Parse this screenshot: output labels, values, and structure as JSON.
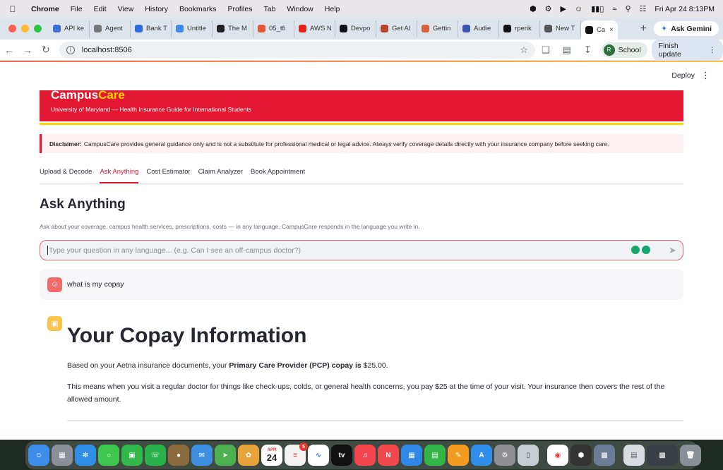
{
  "menubar": {
    "app": "Chrome",
    "items": [
      "File",
      "Edit",
      "View",
      "History",
      "Bookmarks",
      "Profiles",
      "Tab",
      "Window",
      "Help"
    ],
    "clock": "Fri Apr 24  8:13PM"
  },
  "tabs": [
    {
      "title": "API ke",
      "color": "#3a6fd8"
    },
    {
      "title": "Agent",
      "color": "#777777"
    },
    {
      "title": "Bank T",
      "color": "#2d6ae3"
    },
    {
      "title": "Untitle",
      "color": "#4285f4"
    },
    {
      "title": "The M",
      "color": "#222222"
    },
    {
      "title": "05_tfi",
      "color": "#e8553a"
    },
    {
      "title": "AWS N",
      "color": "#e62117"
    },
    {
      "title": "Devpo",
      "color": "#111111"
    },
    {
      "title": "Get AI",
      "color": "#b5432f"
    },
    {
      "title": "Gettin",
      "color": "#d9613f"
    },
    {
      "title": "Audie",
      "color": "#3955b8"
    },
    {
      "title": "rperik",
      "color": "#111111"
    },
    {
      "title": "New T",
      "color": "#555555"
    },
    {
      "title": "Ca",
      "color": "#111111"
    }
  ],
  "gemini_label": "Ask Gemini",
  "url": "localhost:8506",
  "profile": {
    "initial": "R",
    "name": "School"
  },
  "finish_update": "Finish update",
  "app": {
    "deploy": "Deploy",
    "brand_campus": "Campus",
    "brand_care": "Care",
    "subtitle": "University of Maryland — Health Insurance Guide for International Students",
    "disclaimer_label": "Disclaimer:",
    "disclaimer_text": "CampusCare provides general guidance only and is not a substitute for professional medical or legal advice. Always verify coverage details directly with your insurance company before seeking care.",
    "tabs": [
      "Upload & Decode",
      "Ask Anything",
      "Cost Estimator",
      "Claim Analyzer",
      "Book Appointment"
    ],
    "active_tab": "Ask Anything",
    "heading": "Ask Anything",
    "caption": "Ask about your coverage, campus health services, prescriptions, costs — in any language. CampusCare responds in the language you write in.",
    "input_placeholder": "Type your question in any language... (e.g. Can I see an off-campus doctor?)",
    "user_message": "what is my copay",
    "response_heading": "Your Copay Information",
    "response_p1_pre": "Based on your Aetna insurance documents, your ",
    "response_p1_bold": "Primary Care Provider (PCP) copay is",
    "response_p1_post": " $25.00.",
    "response_p2": "This means when you visit a regular doctor for things like check-ups, colds, or general health concerns, you pay $25 at the time of your visit. Your insurance then covers the rest of the allowed amount."
  },
  "dock": {
    "calendar_month": "APR",
    "calendar_day": "24",
    "reminders_badge": "5",
    "tv_label": "tv"
  },
  "colors": {
    "umd_red": "#e21833",
    "umd_gold": "#ffd200"
  }
}
